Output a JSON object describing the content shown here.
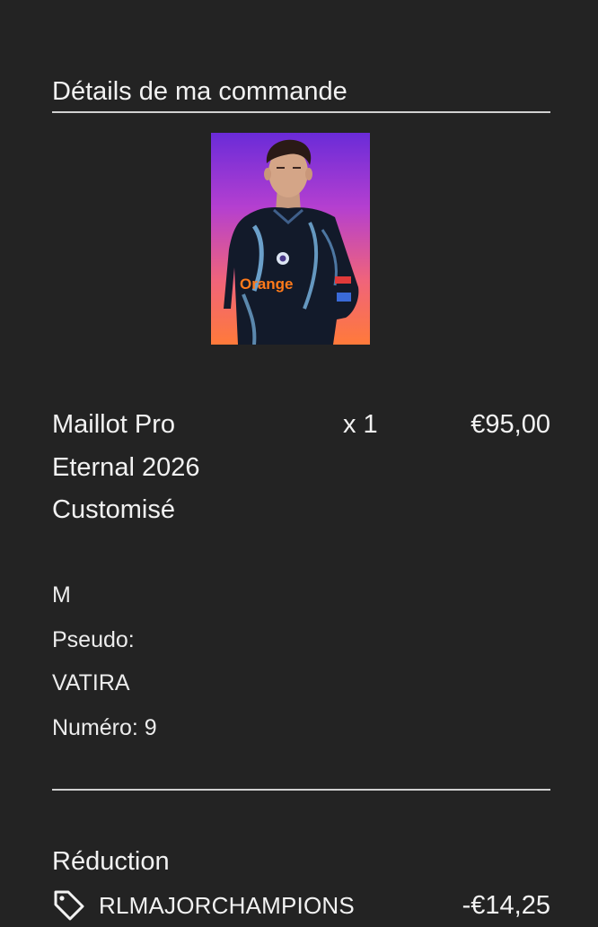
{
  "order": {
    "title": "Détails de ma commande"
  },
  "item": {
    "name": "Maillot Pro Eternal 2026 Customisé",
    "quantity": "x 1",
    "price": "€95,00",
    "size": "M",
    "pseudo_label": "Pseudo:",
    "pseudo_value": "VATIRA",
    "number": "Numéro: 9",
    "image": {
      "description_icon": "jersey-product-photo",
      "jersey_text": "Orange"
    }
  },
  "discount": {
    "title": "Réduction",
    "code": "RLMAJORCHAMPIONS",
    "amount": "-€14,25",
    "icon": "tag-icon"
  },
  "colors": {
    "background": "#232323",
    "text": "#f2f2f2",
    "divider": "#d0d0d0"
  }
}
